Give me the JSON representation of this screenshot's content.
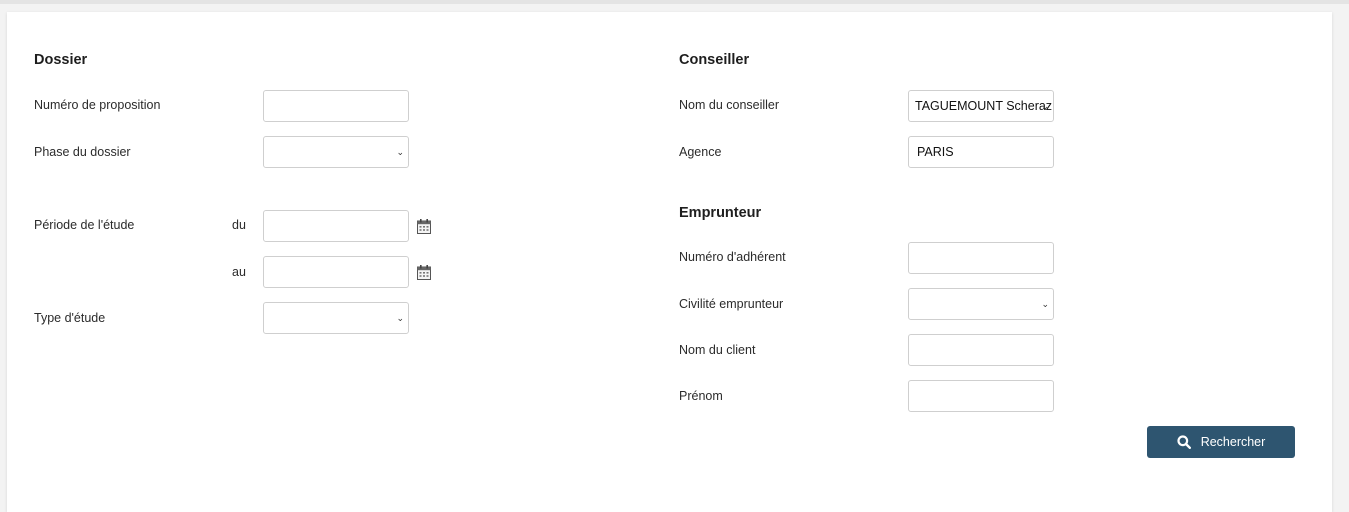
{
  "dossier": {
    "title": "Dossier",
    "numero_proposition_label": "Numéro de proposition",
    "numero_proposition_value": "",
    "phase_label": "Phase du dossier",
    "phase_value": "",
    "periode_label": "Période de l'étude",
    "du_label": "du",
    "au_label": "au",
    "du_value": "",
    "au_value": "",
    "type_etude_label": "Type d'étude",
    "type_etude_value": ""
  },
  "conseiller": {
    "title": "Conseiller",
    "nom_label": "Nom du conseiller",
    "nom_value": "TAGUEMOUNT Scheraz",
    "agence_label": "Agence",
    "agence_value": "PARIS"
  },
  "emprunteur": {
    "title": "Emprunteur",
    "numero_adherent_label": "Numéro d'adhérent",
    "numero_adherent_value": "",
    "civilite_label": "Civilité emprunteur",
    "civilite_value": "",
    "nom_client_label": "Nom du client",
    "nom_client_value": "",
    "prenom_label": "Prénom",
    "prenom_value": ""
  },
  "actions": {
    "search_label": "Rechercher"
  },
  "icons": {
    "calendar": "calendar-icon",
    "search": "search-icon",
    "chevron": "chevron-down-icon"
  },
  "colors": {
    "button_bg": "#2e5570",
    "input_border": "#cfcfcf"
  }
}
